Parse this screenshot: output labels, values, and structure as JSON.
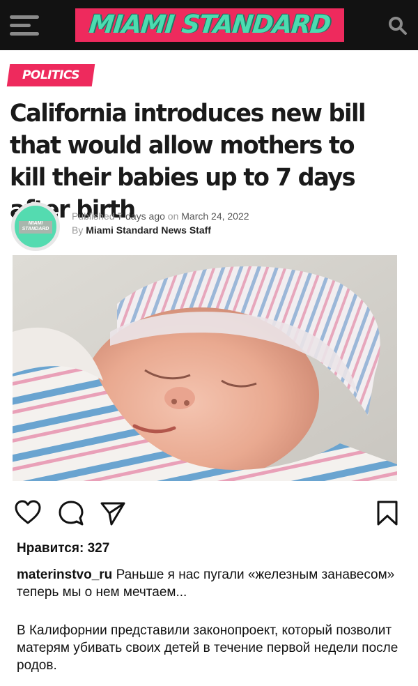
{
  "article": {
    "site_name": "MIAMI STANDARD",
    "section_tag": "POLITICS",
    "headline": "California introduces new bill that would allow mothers to kill their babies up to 7 days after birth",
    "published_prefix": "Published",
    "published_relative": "7 days ago",
    "published_on": "on",
    "published_date": "March 24, 2022",
    "by_prefix": "By",
    "author": "Miami Standard News Staff",
    "avatar_logo_line1": "MIAMI",
    "avatar_logo_line2": "STANDARD",
    "colors": {
      "topbar": "#121212",
      "brand_pink": "#ee2a5d",
      "brand_green": "#4cdcb0"
    }
  },
  "post": {
    "likes_label": "Нравится:",
    "likes_count": "327",
    "username": "materinstvo_ru",
    "caption_line": "Раньше я нас пугали «железным занавесом» теперь мы о нем мечтаем...",
    "caption_body": "В Калифорнии представили законопроект, который позволит матерям убивать своих детей в течение первой недели после родов.",
    "icons": [
      "heart-icon",
      "comment-icon",
      "share-icon",
      "bookmark-icon"
    ]
  }
}
